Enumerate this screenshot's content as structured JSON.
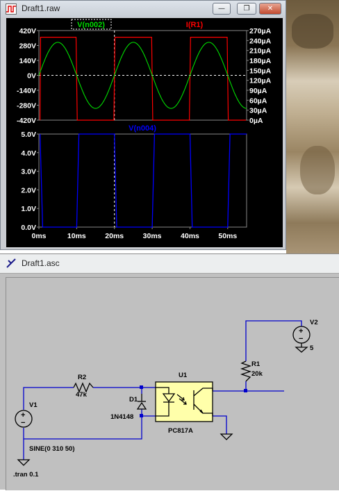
{
  "raw_window": {
    "title": "Draft1.raw",
    "buttons": {
      "minimize": "—",
      "restore": "❐",
      "close": "✕"
    }
  },
  "asc_window": {
    "title": "Draft1.asc"
  },
  "colors": {
    "plot_bg": "#000000",
    "v_n002": "#00dd00",
    "i_r1": "#ff0000",
    "v_n004": "#0000ff",
    "axis_text": "#ffffff",
    "wire": "#0000cc",
    "component_fill": "#ffffaa"
  },
  "chart_data": [
    {
      "type": "line",
      "series": [
        {
          "name": "V(n002)",
          "axis": "left",
          "shape": "sine",
          "amplitude": 310,
          "frequency_hz": 50
        },
        {
          "name": "I(R1)",
          "axis": "right",
          "shape": "square",
          "low": 0,
          "high": 250
        }
      ],
      "xlabel": "",
      "ylabel_left": "",
      "ylabel_right": "",
      "xlim": [
        0,
        55
      ],
      "x_unit": "ms",
      "ylim_left": [
        -420,
        420
      ],
      "ylim_right": [
        0,
        270
      ],
      "left_ticks": [
        "420V",
        "280V",
        "140V",
        "0V",
        "-140V",
        "-280V",
        "-420V"
      ],
      "right_ticks": [
        "270µA",
        "240µA",
        "210µA",
        "180µA",
        "150µA",
        "120µA",
        "90µA",
        "60µA",
        "30µA",
        "0µA"
      ],
      "grid": false,
      "cursor_lines": {
        "x": 20,
        "y_left": 0
      }
    },
    {
      "type": "line",
      "series": [
        {
          "name": "V(n004)",
          "shape": "square",
          "low": 0.0,
          "high": 5.0
        }
      ],
      "xlim": [
        0,
        55
      ],
      "x_unit": "ms",
      "ylim": [
        0,
        5
      ],
      "y_ticks": [
        "5.0V",
        "4.0V",
        "3.0V",
        "2.0V",
        "1.0V",
        "0.0V"
      ],
      "x_ticks": [
        "0ms",
        "10ms",
        "20ms",
        "30ms",
        "40ms",
        "50ms"
      ],
      "grid": false,
      "cursor_lines": {
        "x": 20
      }
    }
  ],
  "schematic": {
    "labels": {
      "v1_name": "V1",
      "v1_value": "SINE(0 310 50)",
      "r2_name": "R2",
      "r2_value": "47k",
      "d1_name": "D1",
      "d1_value": "1N4148",
      "u1_name": "U1",
      "u1_value": "PC817A",
      "r1_name": "R1",
      "r1_value": "20k",
      "v2_name": "V2",
      "v2_value": "5",
      "directive": ".tran 0.1"
    }
  }
}
